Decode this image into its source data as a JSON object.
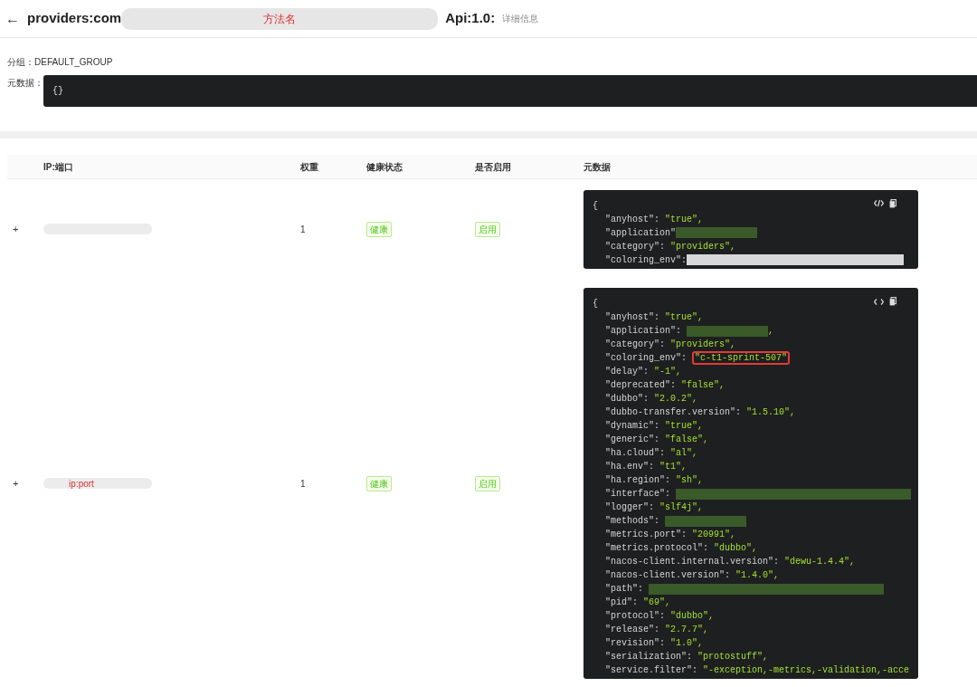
{
  "header": {
    "back": "←",
    "title": "providers:com",
    "title_annotation": "方法名",
    "version": "Api:1.0:",
    "subtitle": "详细信息"
  },
  "group": {
    "label": "分组：",
    "value": "DEFAULT_GROUP"
  },
  "metadata": {
    "label": "元数据：",
    "value": "{}"
  },
  "table": {
    "columns": [
      "IP:端口",
      "权重",
      "健康状态",
      "是否启用",
      "元数据"
    ],
    "rows": [
      {
        "expand": "+",
        "weight": "1",
        "health": "健康",
        "enabled": "启用",
        "code_icon_slashed": true,
        "lines": [
          {
            "kind": "text",
            "key": "{"
          },
          {
            "kind": "text",
            "key": "\"anyhost\": ",
            "value": "\"true\","
          },
          {
            "kind": "mask",
            "key": "\"application\""
          },
          {
            "kind": "text",
            "key": "\"category\": ",
            "value": "\"providers\","
          },
          {
            "kind": "lightmask",
            "key": "\"coloring_env\":"
          }
        ]
      },
      {
        "expand": "+",
        "ip_annotation": "ip:port",
        "weight": "1",
        "health": "健康",
        "enabled": "启用",
        "code_icon_slashed": false,
        "lines": [
          {
            "kind": "text",
            "key": "{"
          },
          {
            "kind": "text",
            "key": "\"anyhost\": ",
            "value": "\"true\","
          },
          {
            "kind": "mask",
            "key": "\"application\": ",
            "value": ","
          },
          {
            "kind": "text",
            "key": "\"category\": ",
            "value": "\"providers\","
          },
          {
            "kind": "text",
            "key": "\"coloring_env\": ",
            "value": "\"c-t1-sprint-507\"",
            "highlighted": true
          },
          {
            "kind": "text",
            "key": "\"delay\": ",
            "value": "\"-1\","
          },
          {
            "kind": "text",
            "key": "\"deprecated\": ",
            "value": "\"false\","
          },
          {
            "kind": "text",
            "key": "\"dubbo\": ",
            "value": "\"2.0.2\","
          },
          {
            "kind": "text",
            "key": "\"dubbo-transfer.version\": ",
            "value": "\"1.5.10\","
          },
          {
            "kind": "text",
            "key": "\"dynamic\": ",
            "value": "\"true\","
          },
          {
            "kind": "text",
            "key": "\"generic\": ",
            "value": "\"false\","
          },
          {
            "kind": "text",
            "key": "\"ha.cloud\": ",
            "value": "\"al\","
          },
          {
            "kind": "text",
            "key": "\"ha.env\": ",
            "value": "\"t1\","
          },
          {
            "kind": "text",
            "key": "\"ha.region\": ",
            "value": "\"sh\","
          },
          {
            "kind": "widemask",
            "key": "\"interface\": "
          },
          {
            "kind": "text",
            "key": "\"logger\": ",
            "value": "\"slf4j\","
          },
          {
            "kind": "mask",
            "key": "\"methods\": "
          },
          {
            "kind": "text",
            "key": "\"metrics.port\": ",
            "value": "\"20991\","
          },
          {
            "kind": "text",
            "key": "\"metrics.protocol\": ",
            "value": "\"dubbo\","
          },
          {
            "kind": "text",
            "key": "\"nacos-client.internal.version\": ",
            "value": "\"dewu-1.4.4\","
          },
          {
            "kind": "text",
            "key": "\"nacos-client.version\": ",
            "value": "\"1.4.0\","
          },
          {
            "kind": "widemask",
            "key": "\"path\": "
          },
          {
            "kind": "text",
            "key": "\"pid\": ",
            "value": "\"69\","
          },
          {
            "kind": "text",
            "key": "\"protocol\": ",
            "value": "\"dubbo\","
          },
          {
            "kind": "text",
            "key": "\"release\": ",
            "value": "\"2.7.7\","
          },
          {
            "kind": "text",
            "key": "\"revision\": ",
            "value": "\"1.0\","
          },
          {
            "kind": "text",
            "key": "\"serialization\": ",
            "value": "\"protostuff\","
          },
          {
            "kind": "text",
            "key": "\"service.filter\": ",
            "value": "\"-exception,-metrics,-validation,-acce"
          }
        ]
      }
    ]
  }
}
